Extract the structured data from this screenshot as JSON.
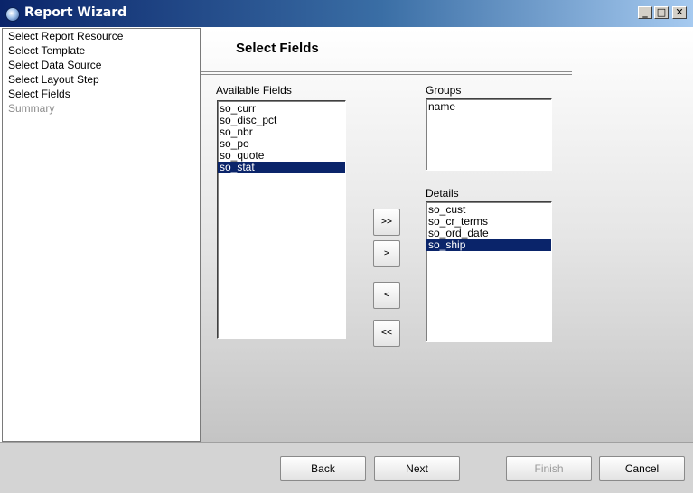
{
  "window": {
    "title": "Report Wizard",
    "minimize": "_",
    "maximize": "□",
    "close": "✕"
  },
  "steps": [
    {
      "label": "Select Report Resource",
      "enabled": true
    },
    {
      "label": "Select Template",
      "enabled": true
    },
    {
      "label": "Select Data Source",
      "enabled": true
    },
    {
      "label": "Select Layout Step",
      "enabled": true
    },
    {
      "label": "Select Fields",
      "enabled": true
    },
    {
      "label": "Summary",
      "enabled": false
    }
  ],
  "main": {
    "heading": "Select Fields",
    "available_label": "Available Fields",
    "available": [
      "so_curr",
      "so_disc_pct",
      "so_nbr",
      "so_po",
      "so_quote",
      "so_stat"
    ],
    "available_selected": "so_stat",
    "groups_label": "Groups",
    "groups": [
      "name"
    ],
    "details_label": "Details",
    "details": [
      "so_cust",
      "so_cr_terms",
      "so_ord_date",
      "so_ship"
    ],
    "details_selected": "so_ship",
    "move_all_right": ">>",
    "move_right": ">",
    "move_left": "<",
    "move_all_left": "<<"
  },
  "buttons": {
    "back": "Back",
    "next": "Next",
    "finish": "Finish",
    "cancel": "Cancel"
  },
  "colors": {
    "selection": "#0a246a",
    "title_start": "#0a246a",
    "title_end": "#a6caf0"
  }
}
